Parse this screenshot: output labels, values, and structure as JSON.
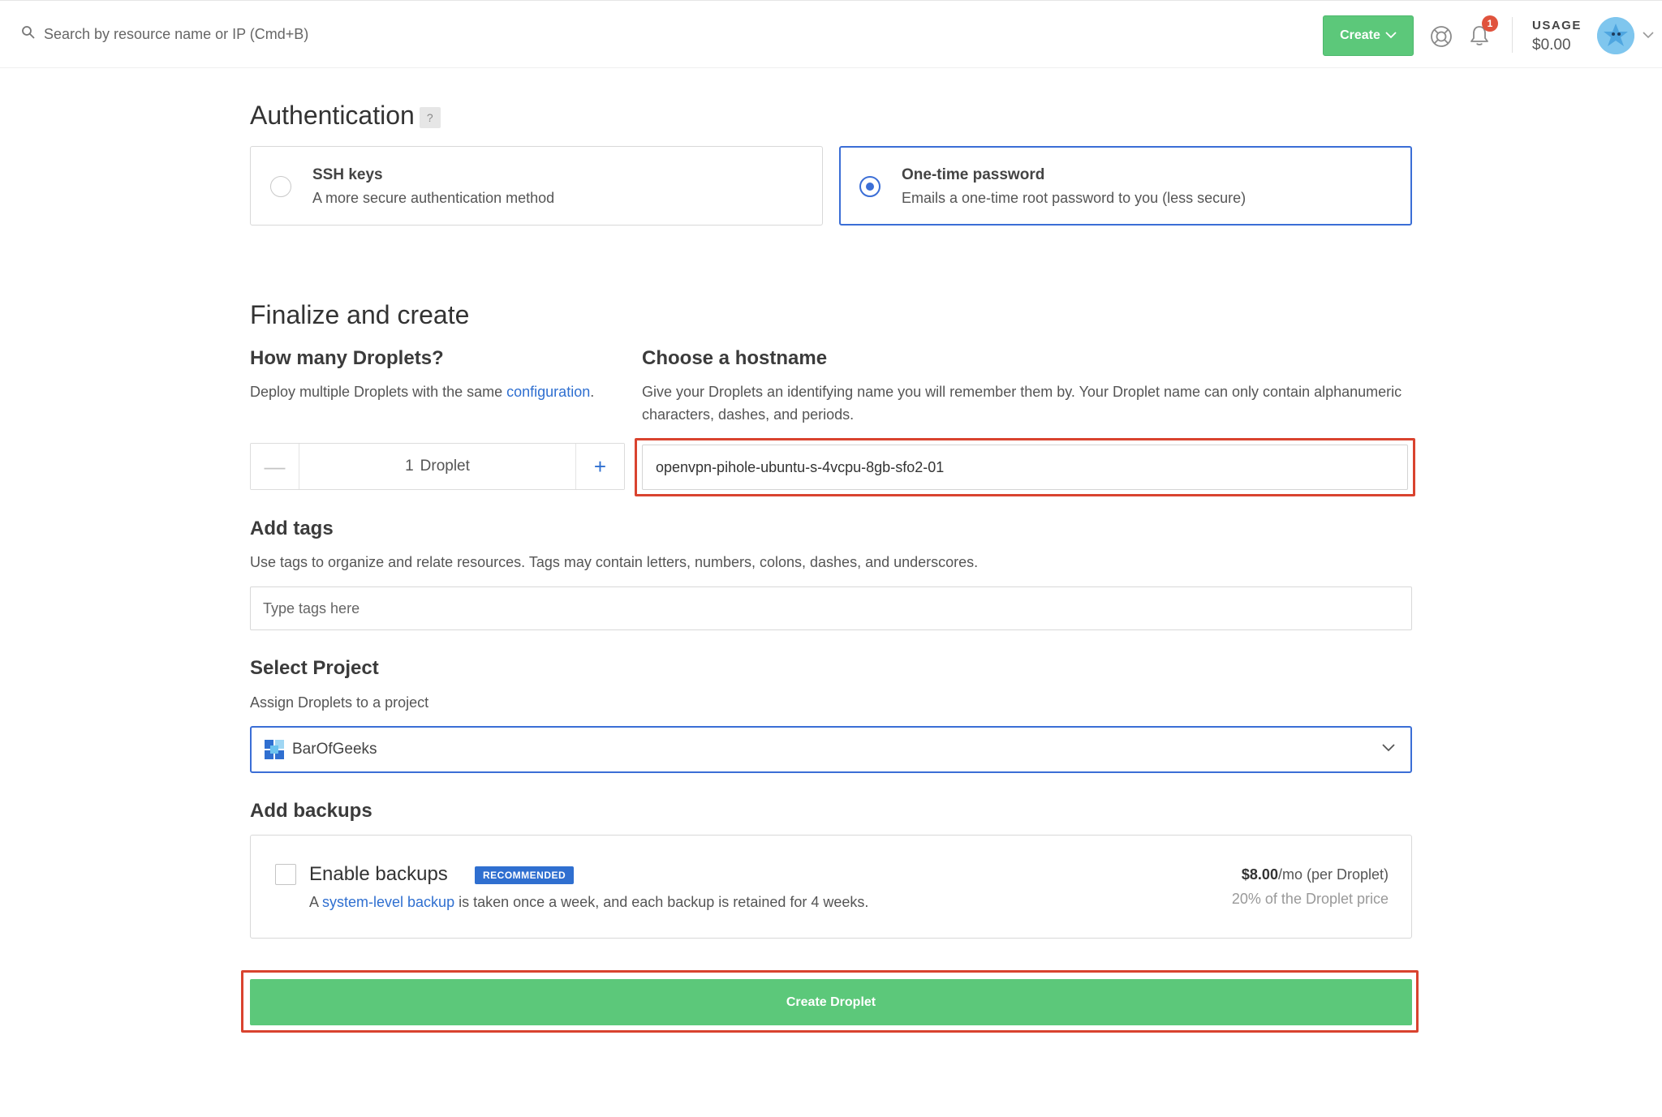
{
  "topbar": {
    "search_placeholder": "Search by resource name or IP (Cmd+B)",
    "create_label": "Create",
    "notification_count": "1",
    "usage_label": "USAGE",
    "usage_value": "$0.00"
  },
  "authentication": {
    "title": "Authentication",
    "help": "?",
    "options": [
      {
        "title": "SSH keys",
        "desc": "A more secure authentication method",
        "selected": false
      },
      {
        "title": "One-time password",
        "desc": "Emails a one-time root password to you (less secure)",
        "selected": true
      }
    ]
  },
  "finalize": {
    "title": "Finalize and create",
    "droplets": {
      "title": "How many Droplets?",
      "desc_prefix": "Deploy multiple Droplets with the same ",
      "desc_link": "configuration",
      "desc_suffix": ".",
      "count": "1",
      "unit": "Droplet",
      "minus": "—",
      "plus": "+"
    },
    "hostname": {
      "title": "Choose a hostname",
      "desc": "Give your Droplets an identifying name you will remember them by. Your Droplet name can only contain alphanumeric characters, dashes, and periods.",
      "value": "openvpn-pihole-ubuntu-s-4vcpu-8gb-sfo2-01"
    }
  },
  "tags": {
    "title": "Add tags",
    "desc": "Use tags to organize and relate resources. Tags may contain letters, numbers, colons, dashes, and underscores.",
    "placeholder": "Type tags here"
  },
  "project": {
    "title": "Select Project",
    "desc": "Assign Droplets to a project",
    "selected": "BarOfGeeks"
  },
  "backups": {
    "title": "Add backups",
    "enable_label": "Enable backups",
    "badge": "RECOMMENDED",
    "desc_prefix": "A ",
    "desc_link": "system-level backup",
    "desc_suffix": " is taken once a week, and each backup is retained for 4 weeks.",
    "price_amount": "$8.00",
    "price_unit": "/mo (per Droplet)",
    "price_sub": "20% of the Droplet price"
  },
  "create_button": "Create Droplet",
  "colors": {
    "primary_green": "#5cc87a",
    "accent_blue": "#3b6ed6",
    "highlight_red": "#d9432f"
  }
}
